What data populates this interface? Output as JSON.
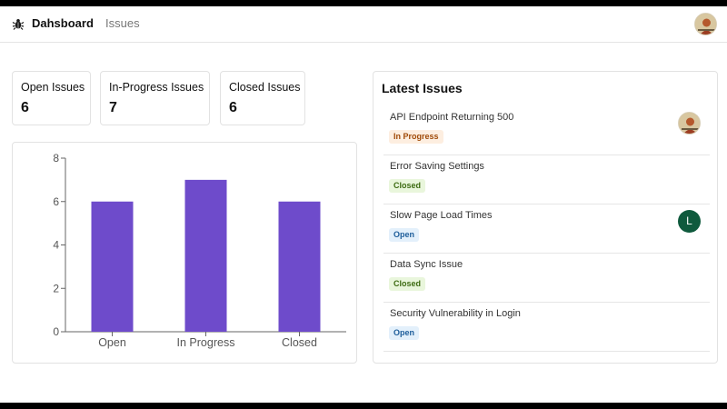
{
  "navbar": {
    "brand_label": "Dahsboard",
    "issues_link": "Issues",
    "logo_icon": "bug-icon",
    "user_avatar_icon": "user-avatar-photo"
  },
  "stats": [
    {
      "label": "Open Issues",
      "value": "6"
    },
    {
      "label": "In-Progress Issues",
      "value": "7"
    },
    {
      "label": "Closed Issues",
      "value": "6"
    }
  ],
  "latest": {
    "title": "Latest Issues",
    "issues": [
      {
        "title": "API Endpoint Returning 500",
        "status": "In Progress",
        "assignee": "photo"
      },
      {
        "title": "Error Saving Settings",
        "status": "Closed",
        "assignee": ""
      },
      {
        "title": "Slow Page Load Times",
        "status": "Open",
        "assignee": "L"
      },
      {
        "title": "Data Sync Issue",
        "status": "Closed",
        "assignee": ""
      },
      {
        "title": "Security Vulnerability in Login",
        "status": "Open",
        "assignee": ""
      }
    ]
  },
  "status_colors": {
    "In Progress": {
      "bg": "#fdeee0",
      "fg": "#a04a08"
    },
    "Closed": {
      "bg": "#e9f6dc",
      "fg": "#3d6b12"
    },
    "Open": {
      "bg": "#e3f0fb",
      "fg": "#1d5d9a"
    }
  },
  "chart_data": {
    "type": "bar",
    "categories": [
      "Open",
      "In Progress",
      "Closed"
    ],
    "values": [
      6,
      7,
      6
    ],
    "ylim": [
      0,
      8
    ],
    "yticks": [
      0,
      2,
      4,
      6,
      8
    ],
    "bar_color": "#6e4bcb",
    "grid": false
  }
}
